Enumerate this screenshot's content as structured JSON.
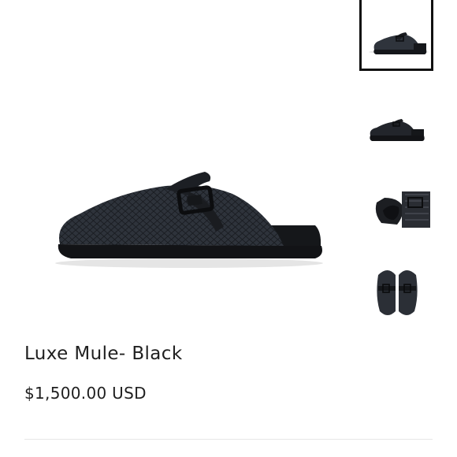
{
  "product": {
    "title": "Luxe Mule- Black",
    "price": "$1,500.00 USD",
    "main_image_icon": "black-python-mule-clog-side-view",
    "selected_thumbnail": 1
  },
  "thumbnails": [
    {
      "icon": "mule-side-view-thumbnail",
      "selected": true
    },
    {
      "icon": "mule-side-profile-thumbnail",
      "selected": false
    },
    {
      "icon": "mule-insole-buckle-thumbnail",
      "selected": false
    },
    {
      "icon": "mule-pair-top-view-thumbnail",
      "selected": false
    }
  ],
  "colors": {
    "text": "#1f1f1f",
    "thumbnail_border": "#111111",
    "divider": "#e6e6e6",
    "shoe": "#2b2f36"
  }
}
